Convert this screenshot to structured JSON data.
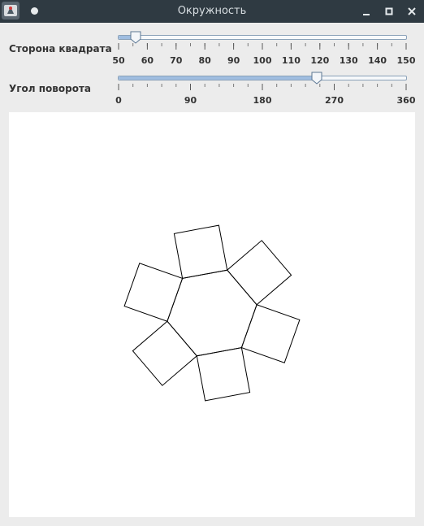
{
  "window": {
    "title": "Окружность",
    "icons": {
      "app": "java-app-icon",
      "menu": "window-menu-dot-icon",
      "minimize": "minimize-icon",
      "maximize": "maximize-icon",
      "close": "close-icon"
    }
  },
  "side_slider": {
    "label": "Сторона квадрата",
    "min": 50,
    "max": 150,
    "value": 56,
    "major_ticks": [
      "50",
      "60",
      "70",
      "80",
      "90",
      "100",
      "110",
      "120",
      "130",
      "140",
      "150"
    ],
    "minor_tick_step": 5
  },
  "angle_slider": {
    "label": "Угол поворота",
    "min": 0,
    "max": 360,
    "value": 248,
    "major_ticks": [
      "0",
      "90",
      "180",
      "270",
      "360"
    ],
    "minor_tick_step": 18
  },
  "drawing": {
    "shape": "hexagon-with-squares",
    "polygon_sides": 6,
    "squares": 6,
    "stroke_color": "#000000",
    "background_color": "#ffffff"
  },
  "colors": {
    "titlebar": "#2f3a42",
    "slider_fill": "#9fbde0",
    "slider_border": "#8aa1b8"
  }
}
